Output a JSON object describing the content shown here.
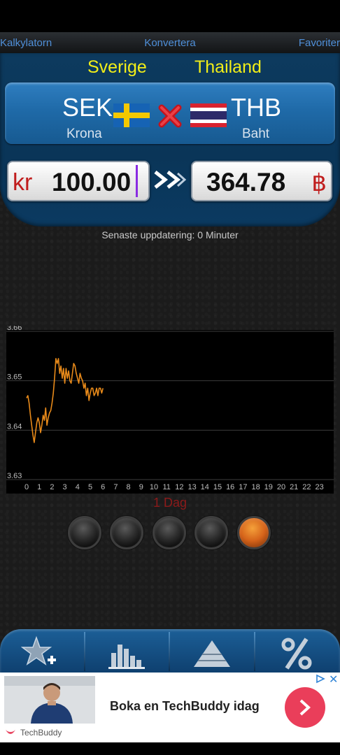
{
  "tabs": {
    "left": "Kalkylatorn",
    "center": "Konvertera",
    "right": "Favoriter"
  },
  "from": {
    "country": "Sverige",
    "code": "SEK",
    "name": "Krona",
    "symbol": "kr",
    "amount": "100.00"
  },
  "to": {
    "country": "Thailand",
    "code": "THB",
    "name": "Baht",
    "symbol": "฿",
    "amount": "364.78"
  },
  "update_text": "Senaste uppdatering: 0 Minuter",
  "period_label": "1 Dag",
  "period_dots": {
    "count": 5,
    "active_index": 4
  },
  "colors": {
    "accent": "#f2ee18",
    "panel": "#0b3a61",
    "line": "#e88a1a",
    "active_dot": "#d5631a",
    "ad_cta": "#ea3e5a"
  },
  "toolbar": {
    "icons": [
      "star-plus-icon",
      "bar-chart-icon",
      "pyramid-icon",
      "percent-icon"
    ]
  },
  "ad": {
    "headline": "Boka en TechBuddy idag",
    "brand": "TechBuddy"
  },
  "chart_data": {
    "type": "line",
    "x_ticks": [
      "0",
      "1",
      "2",
      "3",
      "4",
      "5",
      "6",
      "7",
      "8",
      "9",
      "10",
      "11",
      "12",
      "13",
      "14",
      "15",
      "16",
      "17",
      "18",
      "19",
      "20",
      "21",
      "22",
      "23"
    ],
    "y_ticks": [
      "3.66",
      "3.65",
      "3.64",
      "3.63"
    ],
    "ylim": [
      3.63,
      3.66
    ],
    "xlim": [
      0,
      23.8
    ],
    "grid": true,
    "series": [
      {
        "x": [
          0,
          0.1,
          0.2,
          0.3,
          0.4,
          0.5,
          0.6,
          0.7,
          0.8,
          0.9,
          1,
          1.1,
          1.2,
          1.3,
          1.4,
          1.5,
          1.6,
          1.7,
          1.8,
          1.9,
          2,
          2.1,
          2.2,
          2.3,
          2.4,
          2.5,
          2.6,
          2.7,
          2.8,
          2.9,
          3,
          3.1,
          3.2,
          3.3,
          3.4,
          3.5,
          3.6,
          3.7,
          3.8,
          3.9,
          4,
          4.1,
          4.2,
          4.3,
          4.4,
          4.5,
          4.6,
          4.7,
          4.8,
          4.9,
          5,
          5.1,
          5.2,
          5.3,
          5.4,
          5.5,
          5.6,
          5.7,
          5.8,
          5.9,
          6
        ],
        "y": [
          3.6465,
          3.647,
          3.6455,
          3.643,
          3.641,
          3.639,
          3.6375,
          3.6395,
          3.6415,
          3.6425,
          3.6415,
          3.6395,
          3.641,
          3.643,
          3.642,
          3.6445,
          3.641,
          3.6425,
          3.6435,
          3.644,
          3.6455,
          3.6475,
          3.6505,
          3.6545,
          3.6535,
          3.6545,
          3.6515,
          3.653,
          3.6505,
          3.6525,
          3.6495,
          3.6525,
          3.6505,
          3.652,
          3.65,
          3.6495,
          3.6515,
          3.6535,
          3.653,
          3.6515,
          3.6505,
          3.6495,
          3.6515,
          3.6505,
          3.65,
          3.6485,
          3.6495,
          3.647,
          3.6485,
          3.646,
          3.6475,
          3.6485,
          3.6485,
          3.647,
          3.6475,
          3.6485,
          3.647,
          3.6485,
          3.6485,
          3.6475,
          3.6485
        ]
      }
    ]
  }
}
